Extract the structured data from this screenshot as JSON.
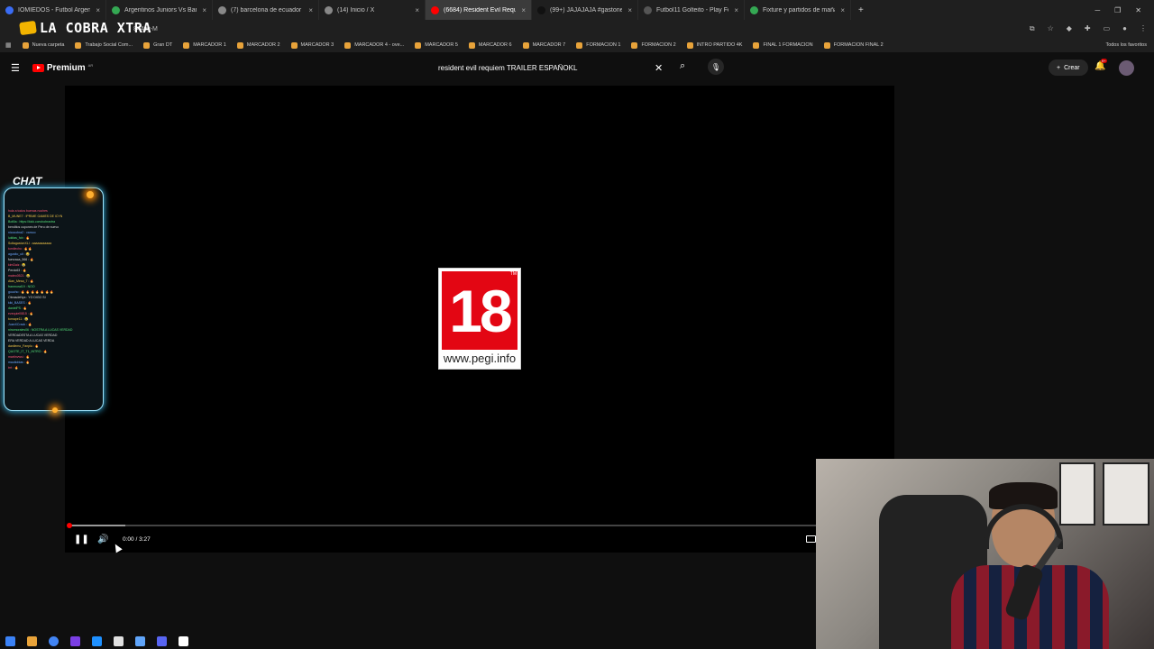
{
  "browser": {
    "tabs": [
      {
        "label": "IOMIEDOS - Futbol Argentin",
        "color": "#3a6cf4",
        "active": false
      },
      {
        "label": "Argentinos Juniors Vs Barcelo",
        "color": "#34a853",
        "active": false
      },
      {
        "label": "(7) barcelona de ecuador - Bus",
        "color": "#888888",
        "active": false
      },
      {
        "label": "(14) Inicio / X",
        "color": "#888888",
        "active": false
      },
      {
        "label": "(6684) Resident Evil Requiem",
        "color": "#ff0000",
        "active": true
      },
      {
        "label": "(99+) JAJAJAJA #gastonedul #",
        "color": "#111111",
        "active": false
      },
      {
        "label": "Futbol11 Golteito - Play Footb",
        "color": "#555555",
        "active": false
      },
      {
        "label": "Fixture y partidos de mañana",
        "color": "#34a853",
        "active": false
      }
    ],
    "close_glyph": "×",
    "new_tab_glyph": "+",
    "window_controls": [
      "─",
      "❐",
      "✕"
    ],
    "url_fragment": "844yy-M",
    "bookmarks": [
      "Nueva carpeta",
      "Trabajo Social Com...",
      "Gran DT",
      "MARCADOR 1",
      "MARCADOR 2",
      "MARCADOR 3",
      "MARCADOR 4 - ove...",
      "MARCADOR 5",
      "MARCADOR 6",
      "MARCADOR 7",
      "FORMACION 1",
      "FORMACION 2",
      "INTRO PARTIDO 4K",
      "FINAL 1 FORMACION",
      "FORMACION FINAL 2"
    ],
    "bookmarks_all": "Todos los favoritos"
  },
  "overlay": {
    "stream_logo": "LA COBRA XTRA",
    "chat_title": "CHAT",
    "chat_lines": [
      {
        "text": "hola a todos buenas noches",
        "cls": "u1"
      },
      {
        "text": "B_MUNE7 : !PRIME GAMES DE ICYN",
        "cls": "u4"
      },
      {
        "text": "Botllia : https://kick.com/cobraxtra",
        "cls": "u2"
      },
      {
        "text": "benditos cupones de Peru de nuevo",
        "cls": ""
      },
      {
        "text": "nicocobra2 : vamoo",
        "cls": "u3"
      },
      {
        "text": "lukitas_fcb : 🔥",
        "cls": "u2"
      },
      {
        "text": "SoltagastonXLI : aaaaaaaaaaa",
        "cls": "u4"
      },
      {
        "text": "tomilecho : 🔥🔥",
        "cls": "u1"
      },
      {
        "text": "agusito_ult : 😂",
        "cls": "u3"
      },
      {
        "text": "fuerzaca_566 : 🔥",
        "cls": ""
      },
      {
        "text": "kimDaiz : 😂",
        "cls": "u1"
      },
      {
        "text": "Perdo63 : 🔥",
        "cls": ""
      },
      {
        "text": "mateo0521 : 😂",
        "cls": "u1"
      },
      {
        "text": "Alan_Mesa_7 : 🔥",
        "cls": "u4"
      },
      {
        "text": "franmoral19 : NOO",
        "cls": "u2"
      },
      {
        "text": "goucho : 🔥 🔥 🔥 🔥 🔥 🔥 🔥",
        "cls": "u3"
      },
      {
        "text": "ObrasdeNyx : YO DIGO SI",
        "cls": ""
      },
      {
        "text": "kiki_BASES : 🔥",
        "cls": "u3"
      },
      {
        "text": "danielPS : 🔥",
        "cls": "u2"
      },
      {
        "text": "ezequiel0815 : 🔥",
        "cls": "u1"
      },
      {
        "text": "tomape11 : 😂",
        "cls": "u4"
      },
      {
        "text": "JuanXCrack : 🔥",
        "cls": "u3"
      },
      {
        "text": "ninomorales06 : NOSTRA A LUCAS VERDAD",
        "cls": "u2"
      },
      {
        "text": "VERDADESTA A LUCAS VERDAD",
        "cls": ""
      },
      {
        "text": "ERA VERDAD A LUCAS VERDA",
        "cls": ""
      },
      {
        "text": "danilemo_Fanplu : 🔥",
        "cls": "u4"
      },
      {
        "text": "QUOTE_IT_T1_INTRO : 🔥",
        "cls": "u2"
      },
      {
        "text": "martinvwsi : 🔥",
        "cls": "u1"
      },
      {
        "text": "mauitobias : 🔥",
        "cls": "u3"
      },
      {
        "text": "trrt : 🔥",
        "cls": "u1"
      }
    ]
  },
  "youtube": {
    "menu_icon": "☰",
    "brand": "Premium",
    "region": "AR",
    "search_value": "resident evil requiem TRAILER ESPAÑOKL",
    "clear_glyph": "✕",
    "search_glyph": "⌕",
    "mic_glyph": "🎙",
    "create_label": "Crear",
    "create_glyph": "+",
    "bell_glyph": "🔔",
    "notif_count": "9+"
  },
  "player": {
    "rating": "18",
    "rating_tm": "TM",
    "rating_url": "www.pegi.info",
    "time_display": "0:00 / 3:27",
    "progress": 0.0,
    "buffered": 0.075,
    "pause_glyph": "❚❚",
    "volume_glyph": "🔊"
  },
  "taskbar": {
    "colors": [
      "#3b82f6",
      "#e8a33a",
      "#4285f4",
      "#7b3fe4",
      "#1e90ff",
      "#e0e0e0",
      "#60a5fa",
      "#5865f2",
      "#ffffff"
    ]
  }
}
